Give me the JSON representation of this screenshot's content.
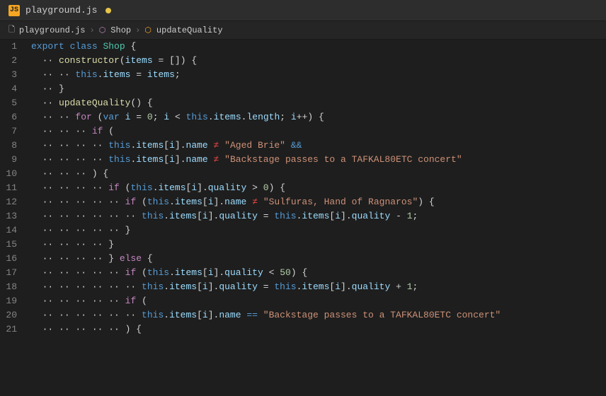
{
  "titleBar": {
    "icon": "JS",
    "filename": "playground.js",
    "modified": true
  },
  "breadcrumb": {
    "file": "playground.js",
    "class": "Shop",
    "method": "updateQuality"
  },
  "lines": [
    {
      "num": 1,
      "indent": 0,
      "content": "export_class_Shop_{"
    },
    {
      "num": 2,
      "indent": 1,
      "content": "constructor(items_=_[])_{"
    },
    {
      "num": 3,
      "indent": 2,
      "content": "this.items_=_items;"
    },
    {
      "num": 4,
      "indent": 1,
      "content": "}"
    },
    {
      "num": 5,
      "indent": 1,
      "content": "updateQuality()_{"
    },
    {
      "num": 6,
      "indent": 2,
      "content": "for_(var_i_=_0;_i_<_this.items.length;_i++)_{"
    },
    {
      "num": 7,
      "indent": 3,
      "content": "if_("
    },
    {
      "num": 8,
      "indent": 4,
      "content": "this.items[i].name_!=_\"Aged_Brie\"_&&"
    },
    {
      "num": 9,
      "indent": 4,
      "content": "this.items[i].name_!=_\"Backstage_passes_to_a_TAFKAL80ETC_concert\""
    },
    {
      "num": 10,
      "indent": 3,
      "content": ")_{"
    },
    {
      "num": 11,
      "indent": 4,
      "content": "if_(this.items[i].quality_>_0)_{"
    },
    {
      "num": 12,
      "indent": 5,
      "content": "if_(this.items[i].name_!=_\"Sulfuras,_Hand_of_Ragnaros\")_{"
    },
    {
      "num": 13,
      "indent": 6,
      "content": "this.items[i].quality_=_this.items[i].quality_-_1;"
    },
    {
      "num": 14,
      "indent": 5,
      "content": "}"
    },
    {
      "num": 15,
      "indent": 4,
      "content": "}"
    },
    {
      "num": 16,
      "indent": 4,
      "content": "}_else_{"
    },
    {
      "num": 17,
      "indent": 5,
      "content": "if_(this.items[i].quality_<_50)_{"
    },
    {
      "num": 18,
      "indent": 6,
      "content": "this.items[i].quality_=_this.items[i].quality_+_1;"
    },
    {
      "num": 19,
      "indent": 5,
      "content": "if_("
    },
    {
      "num": 20,
      "indent": 6,
      "content": "this.items[i].name_==_\"Backstage_passes_to_a_TAFKAL80ETC_concert\""
    },
    {
      "num": 21,
      "indent": 5,
      "content": ")_{"
    }
  ]
}
